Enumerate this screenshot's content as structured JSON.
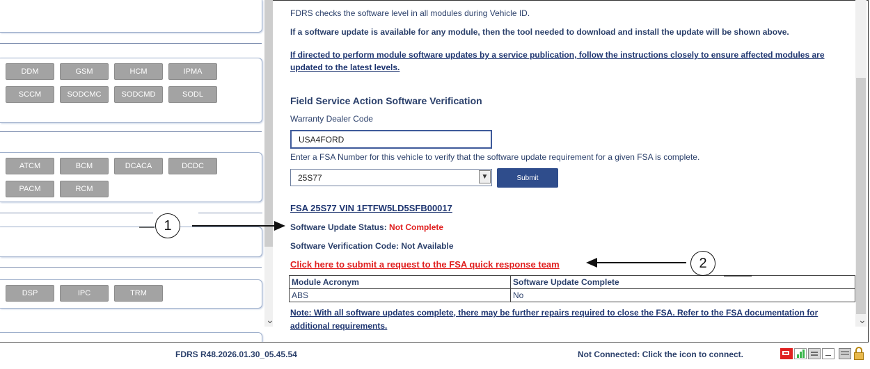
{
  "left_panel": {
    "group1_buttons": [
      "DDM",
      "GSM",
      "HCM",
      "IPMA",
      "SCCM",
      "SODCMC",
      "SODCMD",
      "SODL"
    ],
    "group2_buttons": [
      "ATCM",
      "BCM",
      "DCACA",
      "DCDC",
      "PACM",
      "RCM"
    ],
    "group3_buttons": [
      "DSP",
      "IPC",
      "TRM"
    ]
  },
  "main": {
    "intro": "FDRS checks the software level in all modules during Vehicle ID.",
    "update_notice": "If a software update is available for any module, then the tool needed to download and install the update will be shown above.",
    "service_pub_line1": "If directed to perform module software updates by a service publication, follow the instructions closely to ensure affected modules are",
    "service_pub_line2": "updated to the latest levels.",
    "section_title": "Field Service Action Software Verification",
    "dealer_code_label": "Warranty Dealer Code",
    "dealer_code_value": "USA4FORD",
    "fsa_prompt": "Enter a FSA Number for this vehicle to verify that the software update requirement for a given FSA is complete.",
    "fsa_selected": "25S77",
    "submit_label": "Submit",
    "fsa_heading": "FSA 25S77 VIN 1FTFW5LD5SFB00017",
    "status_label": "Software Update Status: ",
    "status_value": "Not Complete",
    "verification_code": "Software Verification Code: Not Available",
    "request_link": "Click here to submit a request to the FSA quick response team",
    "table": {
      "headers": [
        "Module Acronym",
        "Software Update Complete"
      ],
      "rows": [
        [
          "ABS",
          "No"
        ]
      ]
    },
    "note_line1": "Note: With all software updates complete, there may be further repairs required to close the FSA. Refer to the FSA documentation for",
    "note_line2": "additional requirements."
  },
  "footer": {
    "version": "FDRS R48.2026.01.30_05.45.54",
    "connection_status": "Not Connected: Click the icon to connect."
  },
  "callouts": [
    "1",
    "2"
  ],
  "colors": {
    "accent": "#2f4d8c",
    "alert_red": "#e02020",
    "module_button": "#a3a3a3"
  }
}
